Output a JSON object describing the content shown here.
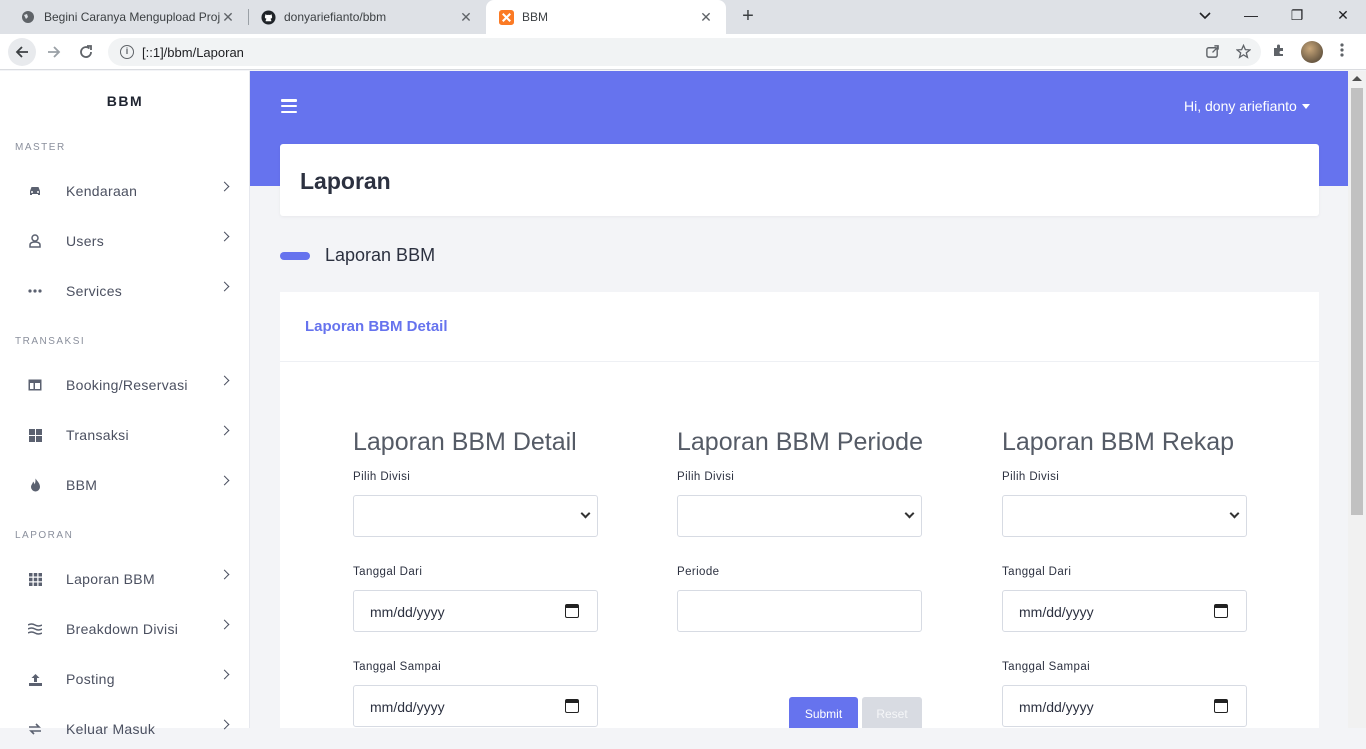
{
  "browser": {
    "tabs": [
      {
        "title": "Begini Caranya Mengupload Proj",
        "close": "✕"
      },
      {
        "title": "donyariefianto/bbm",
        "close": "✕"
      },
      {
        "title": "BBM",
        "close": "✕"
      }
    ],
    "new_tab": "+",
    "window_controls": {
      "minimize": "—",
      "restore": "❐",
      "close": "✕"
    },
    "url": "[::1]/bbm/Laporan"
  },
  "sidebar": {
    "brand": "BBM",
    "sections": [
      {
        "title": "MASTER",
        "items": [
          {
            "label": "Kendaraan",
            "icon": "car-icon"
          },
          {
            "label": "Users",
            "icon": "user-icon"
          },
          {
            "label": "Services",
            "icon": "dots-icon"
          }
        ]
      },
      {
        "title": "TRANSAKSI",
        "items": [
          {
            "label": "Booking/Reservasi",
            "icon": "table-icon"
          },
          {
            "label": "Transaksi",
            "icon": "grid-icon"
          },
          {
            "label": "BBM",
            "icon": "fire-icon"
          }
        ]
      },
      {
        "title": "LAPORAN",
        "items": [
          {
            "label": "Laporan BBM",
            "icon": "grid-icon"
          },
          {
            "label": "Breakdown Divisi",
            "icon": "layers-icon"
          },
          {
            "label": "Posting",
            "icon": "upload-icon"
          },
          {
            "label": "Keluar Masuk",
            "icon": "exchange-icon"
          }
        ]
      }
    ]
  },
  "topbar": {
    "user": "Hi, dony ariefianto"
  },
  "page": {
    "title": "Laporan"
  },
  "section": {
    "title": "Laporan BBM"
  },
  "card": {
    "header": "Laporan BBM Detail"
  },
  "forms": [
    {
      "title": "Laporan BBM Detail",
      "divisi_label": "Pilih Divisi",
      "divisi_value": "",
      "from_label": "Tanggal Dari",
      "from_placeholder": "mm/dd/yyyy",
      "to_label": "Tanggal Sampai",
      "to_placeholder": "mm/dd/yyyy"
    },
    {
      "title": "Laporan BBM Periode",
      "divisi_label": "Pilih Divisi",
      "divisi_value": "",
      "periode_label": "Periode",
      "periode_value": "",
      "submit": "Submit",
      "reset": "Reset"
    },
    {
      "title": "Laporan BBM Rekap",
      "divisi_label": "Pilih Divisi",
      "divisi_value": "",
      "from_label": "Tanggal Dari",
      "from_placeholder": "mm/dd/yyyy",
      "to_label": "Tanggal Sampai",
      "to_placeholder": "mm/dd/yyyy"
    }
  ],
  "colors": {
    "accent": "#6673ee",
    "sidebar_bg": "#ffffff",
    "page_bg": "#f3f4f7"
  }
}
